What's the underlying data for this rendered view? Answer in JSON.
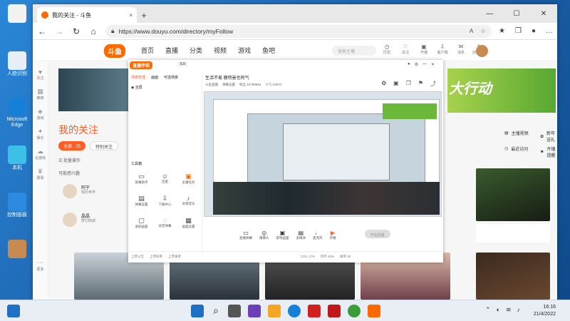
{
  "desktop": {
    "icons": [
      {
        "label": "",
        "color": "#1f9d55"
      },
      {
        "label": "人脸识别",
        "color": "#f0f4f8"
      },
      {
        "label": "Microsoft Edge",
        "color": "#1480d8"
      },
      {
        "label": "本机",
        "color": "#3cc0e8"
      },
      {
        "label": "控制面板",
        "color": "#2c8ae0"
      },
      {
        "label": "",
        "color": "#c98a52"
      }
    ]
  },
  "browser": {
    "tab_title": "我的关注 - 斗鱼",
    "tab_close": "×",
    "new_tab": "+",
    "url": "https://www.douyu.com/directory/myFollow",
    "window": {
      "minimize": "—",
      "maximize": "☐",
      "close": "✕"
    }
  },
  "douyu": {
    "logo": "斗鱼",
    "nav": [
      "首页",
      "直播",
      "分类",
      "视频",
      "游戏",
      "鱼吧"
    ],
    "search_placeholder": "搜索主播",
    "nav_icons": [
      "历史",
      "关注",
      "开播",
      "客户端",
      "消息",
      "创作中心"
    ],
    "left_bar": [
      "关注",
      "推荐",
      "游戏",
      "娱乐",
      "云游戏",
      "赛事",
      "更多"
    ],
    "page_title": "我的关注",
    "filter_all": "全部 · 25",
    "filter_special": "特别关注",
    "batch": "批量操作",
    "section_offline": "可能感兴趣",
    "users": [
      {
        "name": "阿于",
        "desc": "我的世界"
      },
      {
        "name": "晶晶",
        "desc": "梦幻西游"
      }
    ],
    "right_links": [
      "主播视频",
      "新年送礼",
      "最近访问",
      "开播提醒"
    ],
    "banner_text": "大行动",
    "badge_count": "17"
  },
  "overlay": {
    "logo": "直播伴侣",
    "version": "5.0",
    "tabs": [
      "场景管理",
      "画面",
      "可选场景"
    ],
    "scene_item": "全屏",
    "tool_title": "工具箱",
    "tools": [
      "屏幕助手",
      "连麦",
      "主播任务",
      "弹幕设置",
      "下载中心",
      "背景音乐",
      "录屏画面",
      "语音弹幕",
      "画面设置",
      "发送红包",
      "自动回复",
      "更多"
    ],
    "stream_title": "生活不易 鹿特曼也阿气",
    "stream_meta": [
      "斗鱼直播",
      "弹幕设置",
      "粉丝 10708654",
      "人气 10970"
    ],
    "bottom_tools": [
      "直播弹幕",
      "摄像头",
      "游戏画面",
      "多媒体",
      "麦克风",
      "开播"
    ],
    "start_button": "开始直播",
    "status": [
      "上传公告",
      "上传码率",
      "上传速率",
      "CPU 17%",
      "内存 43%",
      "帧率 60"
    ]
  },
  "taskbar": {
    "clock_time": "16:16",
    "clock_date": "21/4/2022",
    "icons": [
      "#1f6fc5",
      "#222",
      "#5a5aff",
      "#6b3fb7",
      "#f5a623",
      "#1480d8",
      "#d02020",
      "#c01818",
      "#3a9d3a",
      "#ff6a00"
    ]
  }
}
